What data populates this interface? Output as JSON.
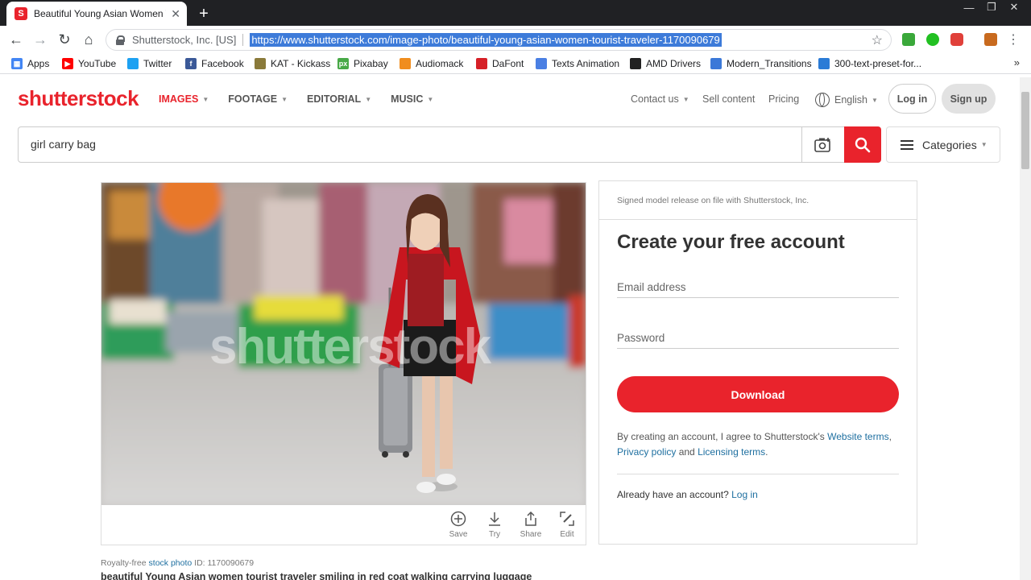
{
  "browser": {
    "tab_title": "Beautiful Young Asian Women To",
    "site_identity": "Shutterstock, Inc. [US]",
    "url": "https://www.shutterstock.com/image-photo/beautiful-young-asian-women-tourist-traveler-1170090679",
    "bookmarks": [
      {
        "label": "Apps",
        "icon": "apps-grid-icon",
        "color": "#4285f4"
      },
      {
        "label": "YouTube",
        "icon": "youtube-icon",
        "color": "#ff0000"
      },
      {
        "label": "Twitter",
        "icon": "twitter-icon",
        "color": "#1da1f2"
      },
      {
        "label": "Facebook",
        "icon": "facebook-icon",
        "color": "#3b5998"
      },
      {
        "label": "KAT - Kickass",
        "icon": "kat-icon",
        "color": "#8a7a3a"
      },
      {
        "label": "Pixabay",
        "icon": "pixabay-icon",
        "color": "#48a947"
      },
      {
        "label": "Audiomack",
        "icon": "audiomack-icon",
        "color": "#f08d1e"
      },
      {
        "label": "DaFont",
        "icon": "dafont-icon",
        "color": "#d62027"
      },
      {
        "label": "Texts Animation",
        "icon": "document-icon",
        "color": "#4a7fe3"
      },
      {
        "label": "AMD Drivers",
        "icon": "amd-icon",
        "color": "#222222"
      },
      {
        "label": "Modern_Transitions",
        "icon": "transitions-icon",
        "color": "#3b78d8"
      },
      {
        "label": "300-text-preset-for...",
        "icon": "link-icon",
        "color": "#2b7bd6"
      }
    ],
    "bookmarks_more": "»"
  },
  "header": {
    "logo": "shutterstock",
    "nav": [
      "IMAGES",
      "FOOTAGE",
      "EDITORIAL",
      "MUSIC"
    ],
    "contact": "Contact us",
    "sell": "Sell content",
    "pricing": "Pricing",
    "language": "English",
    "login": "Log in",
    "signup": "Sign up"
  },
  "search": {
    "value": "girl carry bag",
    "categories": "Categories"
  },
  "image": {
    "watermark": "shutterstock",
    "actions": [
      "Save",
      "Try",
      "Share",
      "Edit"
    ],
    "meta_prefix": "Royalty-free",
    "meta_link": "stock photo",
    "meta_id": "ID: 1170090679",
    "title": "beautiful Young Asian women tourist traveler smiling in red coat walking carrying luggage"
  },
  "account": {
    "release": "Signed model release on file with Shutterstock, Inc.",
    "title": "Create your free account",
    "email_placeholder": "Email address",
    "password_placeholder": "Password",
    "download": "Download",
    "terms_prefix": "By creating an account, I agree to Shutterstock's",
    "terms_link1": "Website terms",
    "terms_sep": ",",
    "terms_link2": "Privacy policy",
    "terms_and": "and",
    "terms_link3": "Licensing terms",
    "terms_end": ".",
    "already": "Already have an account?",
    "already_link": "Log in"
  },
  "colors": {
    "brand": "#e9232c",
    "link": "#1e6fa0"
  }
}
